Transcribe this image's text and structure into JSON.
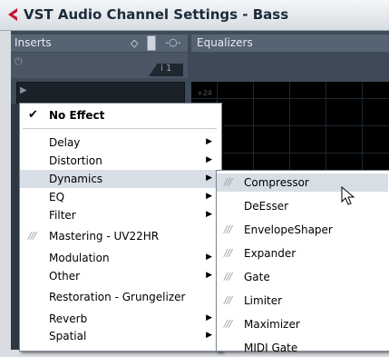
{
  "window": {
    "title": "VST Audio Channel Settings - Bass"
  },
  "inserts": {
    "title": "Inserts",
    "slot_tab": "i 1"
  },
  "equalizers": {
    "title": "Equalizers",
    "scale_label": "+24"
  },
  "main_menu": {
    "items": [
      {
        "label": "No Effect",
        "checked": true
      },
      {
        "label": "Delay",
        "submenu": true
      },
      {
        "label": "Distortion",
        "submenu": true
      },
      {
        "label": "Dynamics",
        "submenu": true,
        "highlighted": true
      },
      {
        "label": "EQ",
        "submenu": true
      },
      {
        "label": "Filter",
        "submenu": true
      },
      {
        "label": "Mastering - UV22HR",
        "mark": "///"
      },
      {
        "label": "Modulation",
        "submenu": true
      },
      {
        "label": "Other",
        "submenu": true
      },
      {
        "label": "Restoration - Grungelizer"
      },
      {
        "label": "Reverb",
        "submenu": true
      },
      {
        "label": "Spatial",
        "submenu": true
      }
    ]
  },
  "dynamics_submenu": {
    "items": [
      {
        "label": "Compressor",
        "mark": "///",
        "highlighted": true
      },
      {
        "label": "DeEsser"
      },
      {
        "label": "EnvelopeShaper",
        "mark": "///"
      },
      {
        "label": "Expander",
        "mark": "///"
      },
      {
        "label": "Gate",
        "mark": "///"
      },
      {
        "label": "Limiter",
        "mark": "///"
      },
      {
        "label": "Maximizer",
        "mark": "///"
      },
      {
        "label": "MIDI Gate"
      }
    ]
  },
  "colors": {
    "panel": "#3e4a57",
    "header": "#556372",
    "highlight": "#d7dee6",
    "title_icon": "#c8102e"
  }
}
